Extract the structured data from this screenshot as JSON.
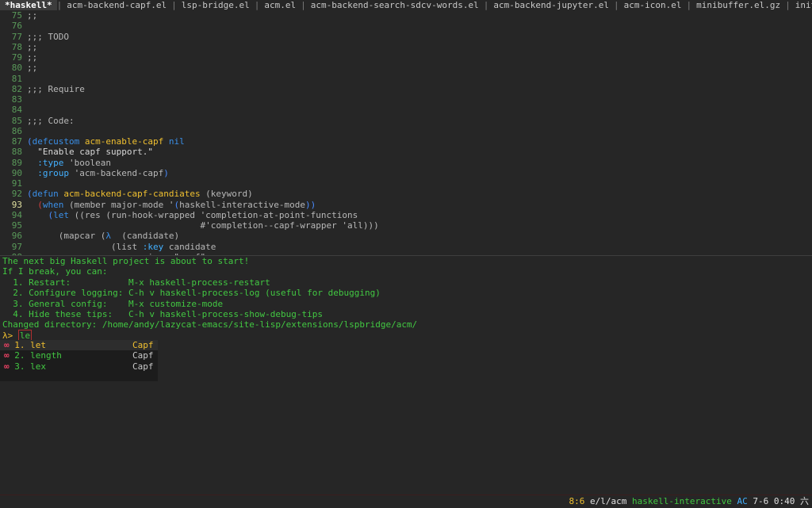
{
  "tabs": [
    {
      "label": "*haskell*",
      "active": true
    },
    {
      "label": "acm-backend-capf.el"
    },
    {
      "label": "lsp-bridge.el"
    },
    {
      "label": "acm.el"
    },
    {
      "label": "acm-backend-search-sdcv-words.el"
    },
    {
      "label": "acm-backend-jupyter.el"
    },
    {
      "label": "acm-icon.el"
    },
    {
      "label": "minibuffer.el.gz"
    },
    {
      "label": "init-l"
    }
  ],
  "editor": {
    "current_line": "93",
    "lines": [
      {
        "n": "75",
        "text": ";;"
      },
      {
        "n": "76",
        "text": ""
      },
      {
        "n": "77",
        "text": ";;; TODO"
      },
      {
        "n": "78",
        "text": ";;"
      },
      {
        "n": "79",
        "text": ";;"
      },
      {
        "n": "80",
        "text": ";;"
      },
      {
        "n": "81",
        "text": ""
      },
      {
        "n": "82",
        "text": ";;; Require"
      },
      {
        "n": "83",
        "text": ""
      },
      {
        "n": "84",
        "text": ""
      },
      {
        "n": "85",
        "text": ";;; Code:"
      },
      {
        "n": "86",
        "text": ""
      },
      {
        "n": "87",
        "parts": [
          [
            "par1",
            "("
          ],
          [
            "kw",
            "defcustom"
          ],
          [
            "code",
            " "
          ],
          [
            "fn",
            "acm-enable-capf"
          ],
          [
            "code",
            " "
          ],
          [
            "kw",
            "nil"
          ]
        ]
      },
      {
        "n": "88",
        "parts": [
          [
            "str",
            "  \"Enable capf support.\""
          ]
        ]
      },
      {
        "n": "89",
        "parts": [
          [
            "code",
            "  "
          ],
          [
            "key",
            ":type"
          ],
          [
            "code",
            " 'boolean"
          ]
        ]
      },
      {
        "n": "90",
        "parts": [
          [
            "code",
            "  "
          ],
          [
            "key",
            ":group"
          ],
          [
            "code",
            " 'acm-backend-capf"
          ],
          [
            "par1",
            ")"
          ]
        ]
      },
      {
        "n": "91",
        "text": ""
      },
      {
        "n": "92",
        "parts": [
          [
            "par1",
            "("
          ],
          [
            "kw",
            "defun"
          ],
          [
            "code",
            " "
          ],
          [
            "fn",
            "acm-backend-capf-candiates"
          ],
          [
            "code",
            " (keyword)"
          ]
        ]
      },
      {
        "n": "93",
        "parts": [
          [
            "code",
            "  "
          ],
          [
            "par2",
            "("
          ],
          [
            "kw",
            "when"
          ],
          [
            "code",
            " (member major-mode '"
          ],
          [
            "par1",
            "("
          ],
          [
            "code",
            "haskell-interactive-mode"
          ],
          [
            "par1",
            ")"
          ],
          [
            "par1",
            ")"
          ]
        ]
      },
      {
        "n": "94",
        "parts": [
          [
            "code",
            "    "
          ],
          [
            "par1",
            "("
          ],
          [
            "kw",
            "let"
          ],
          [
            "code",
            " ((res (run-hook-wrapped 'completion-at-point-functions"
          ]
        ]
      },
      {
        "n": "95",
        "parts": [
          [
            "code",
            "                                 #'completion--capf-wrapper 'all)))"
          ]
        ]
      },
      {
        "n": "96",
        "parts": [
          [
            "code",
            "      (mapcar ("
          ],
          [
            "kw",
            "λ"
          ],
          [
            "code",
            "  (candidate)"
          ]
        ]
      },
      {
        "n": "97",
        "parts": [
          [
            "code",
            "                (list "
          ],
          [
            "key",
            ":key"
          ],
          [
            "code",
            " candidate"
          ]
        ]
      },
      {
        "n": "98",
        "parts": [
          [
            "code",
            "                      :icon \"capf\""
          ]
        ]
      }
    ]
  },
  "repl": {
    "lines": [
      "The next big Haskell project is about to start!",
      "If I break, you can:",
      "  1. Restart:           M-x haskell-process-restart",
      "  2. Configure logging: C-h v haskell-process-log (useful for debugging)",
      "  3. General config:    M-x customize-mode",
      "  4. Hide these tips:   C-h v haskell-process-show-debug-tips",
      "Changed directory: /home/andy/lazycat-emacs/site-lisp/extensions/lspbridge/acm/"
    ],
    "prompt": "λ>",
    "input": "le"
  },
  "completion": {
    "items": [
      {
        "num": "1.",
        "label": "let",
        "annotation": "Capf",
        "selected": true
      },
      {
        "num": "2.",
        "label": "length",
        "annotation": "Capf"
      },
      {
        "num": "3.",
        "label": "lex",
        "annotation": "Capf"
      }
    ],
    "icon_glyph": "∞"
  },
  "modeline": {
    "position": "8:6",
    "directory": "e/l/acm",
    "mode": "haskell-interactive",
    "ac": "AC",
    "version": "7-6",
    "time": "0:40",
    "weekday": "六"
  },
  "colors": {
    "background": "#262626",
    "keyword": "#3a8fe8",
    "function_name": "#f0c030",
    "repl_text": "#42c842",
    "completion_icon": "#e04060"
  }
}
